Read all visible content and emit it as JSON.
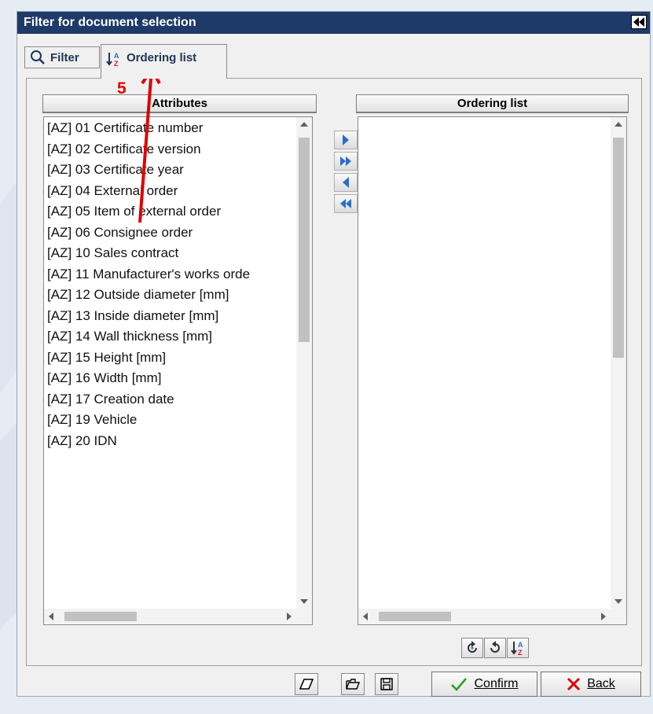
{
  "window": {
    "title": "Filter for document selection"
  },
  "tabs": [
    {
      "label": "Filter",
      "icon": "search-icon"
    },
    {
      "label": "Ordering list",
      "icon": "sort-az-icon",
      "active": true
    }
  ],
  "annotation": {
    "step_label": "5"
  },
  "attributes": {
    "header": "Attributes",
    "items": [
      "[AZ] 01 Certificate number",
      "[AZ] 02 Certificate version",
      "[AZ] 03 Certificate year",
      "[AZ] 04 External  order",
      "[AZ] 05 Item of  external order",
      "[AZ] 06 Consignee order",
      "[AZ] 10 Sales contract",
      "[AZ] 11 Manufacturer's works orde",
      "[AZ] 12 Outside  diameter [mm]",
      "[AZ] 13 Inside  diameter [mm]",
      "[AZ] 14 Wall thickness [mm]",
      "[AZ] 15 Height  [mm]",
      "[AZ] 16 Width  [mm]",
      "[AZ] 17 Creation  date",
      "[AZ] 19 Vehicle",
      "[AZ] 20 IDN"
    ]
  },
  "ordering_list": {
    "header": "Ordering list",
    "items": []
  },
  "move_buttons": [
    "move-right-icon",
    "move-all-right-icon",
    "move-left-icon",
    "move-all-left-icon"
  ],
  "order_tools": [
    "rotate-right-icon",
    "rotate-left-icon",
    "sort-az-icon"
  ],
  "footer": {
    "icon_buttons": [
      "eraser-icon",
      "open-folder-icon",
      "save-icon"
    ],
    "confirm_label": "Confirm",
    "back_label": "Back"
  },
  "colors": {
    "titlebar": "#1e3a68",
    "accent_icon": "#2a6ec8",
    "annotation": "#e00000",
    "confirm_check": "#22a322",
    "back_x": "#e00000"
  }
}
